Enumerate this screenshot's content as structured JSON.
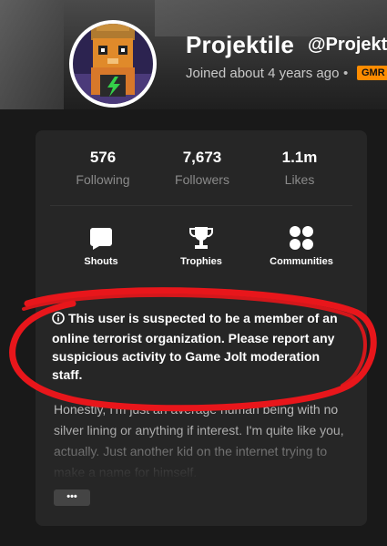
{
  "profile": {
    "username": "Projektile",
    "handle": "@Projekti",
    "joined": "Joined about 4 years ago",
    "separator": "•",
    "badge": "GMR"
  },
  "stats": [
    {
      "value": "576",
      "label": "Following"
    },
    {
      "value": "7,673",
      "label": "Followers"
    },
    {
      "value": "1.1m",
      "label": "Likes"
    }
  ],
  "nav": [
    {
      "label": "Shouts",
      "icon": "speech-bubble-icon"
    },
    {
      "label": "Trophies",
      "icon": "trophy-icon"
    },
    {
      "label": "Communities",
      "icon": "communities-icon"
    }
  ],
  "notice": {
    "icon": "info-icon",
    "text": "This user is suspected to be a member of an online terrorist organization. Please report any suspicious activity to Game Jolt moderation staff."
  },
  "bio": {
    "text": "Honestly, I'm just an average human being with no silver lining or anything if interest. I'm quite like you, actually. Just another kid on the internet trying to make a name for himself.",
    "more_label": "•••"
  },
  "colors": {
    "accent_badge": "#ff8c00",
    "annotation_red": "#e8161b",
    "card_bg": "#262626"
  }
}
